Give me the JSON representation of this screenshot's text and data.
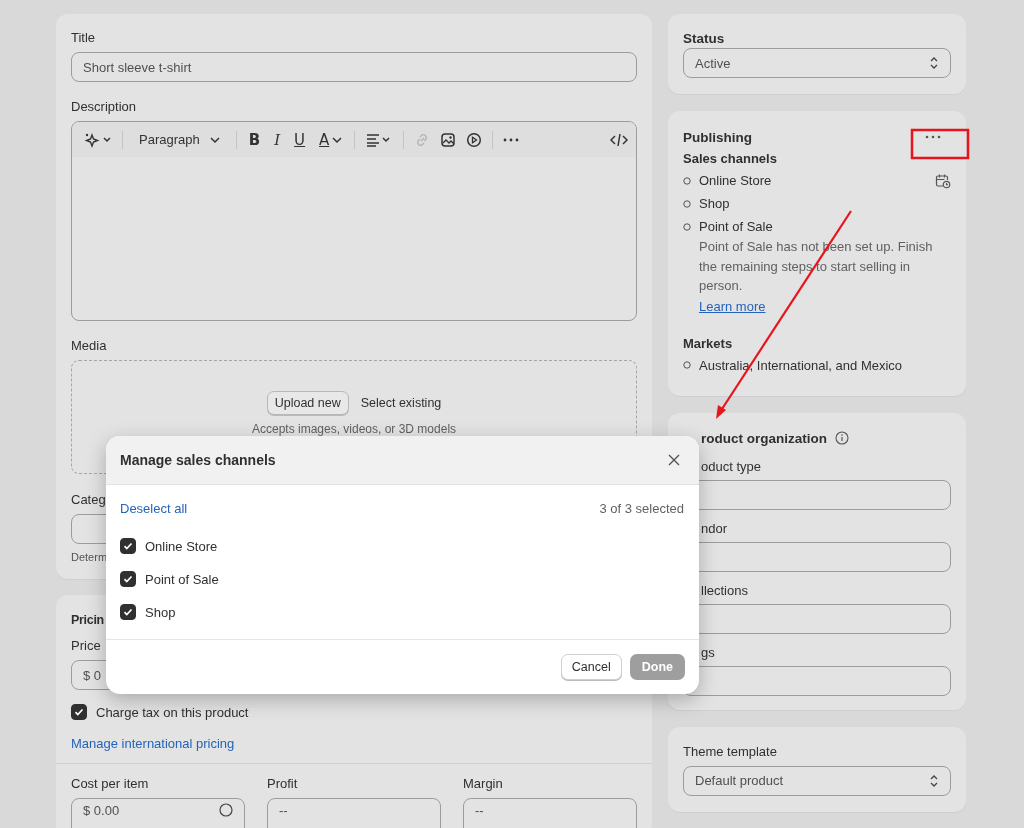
{
  "product": {
    "title": {
      "label": "Title",
      "value": "Short sleeve t-shirt"
    },
    "description": {
      "label": "Description",
      "toolbar": {
        "paragraph": "Paragraph",
        "bold": "B",
        "italic": "I",
        "underline": "U",
        "font_color": "A",
        "link_disabled": true
      }
    },
    "media": {
      "label": "Media",
      "upload": "Upload new",
      "select": "Select existing",
      "hint": "Accepts images, videos, or 3D models"
    },
    "category": {
      "label": "Categ",
      "hint": "Determ"
    }
  },
  "pricing": {
    "title": "Pricin",
    "price_label": "Price",
    "price_value": "$ 0",
    "charge_tax": {
      "label": "Charge tax on this product",
      "checked": true
    },
    "international_link": "Manage international pricing",
    "cost": {
      "label": "Cost per item",
      "value": "$ 0.00"
    },
    "profit": {
      "label": "Profit",
      "value": "--"
    },
    "margin": {
      "label": "Margin",
      "value": "--"
    }
  },
  "status": {
    "label": "Status",
    "value": "Active"
  },
  "publishing": {
    "title": "Publishing",
    "sales_channels_label": "Sales channels",
    "channels": [
      {
        "name": "Online Store",
        "scheduled": true
      },
      {
        "name": "Shop",
        "scheduled": false
      },
      {
        "name": "Point of Sale",
        "scheduled": false,
        "note": "Point of Sale has not been set up. Finish the remaining steps to start selling in person.",
        "link": "Learn more"
      }
    ],
    "markets_label": "Markets",
    "markets": [
      "Australia, International, and Mexico"
    ]
  },
  "organization": {
    "title": "roduct organization",
    "fields": [
      {
        "label": "oduct type"
      },
      {
        "label": "ndor"
      },
      {
        "label": "llections"
      },
      {
        "label": "gs"
      }
    ]
  },
  "theme_template": {
    "label": "Theme template",
    "value": "Default product"
  },
  "modal": {
    "title": "Manage sales channels",
    "deselect": "Deselect all",
    "count": "3 of 3 selected",
    "channels": [
      {
        "name": "Online Store",
        "checked": true
      },
      {
        "name": "Point of Sale",
        "checked": true
      },
      {
        "name": "Shop",
        "checked": true
      }
    ],
    "cancel": "Cancel",
    "done": {
      "label": "Done",
      "disabled": true
    }
  }
}
